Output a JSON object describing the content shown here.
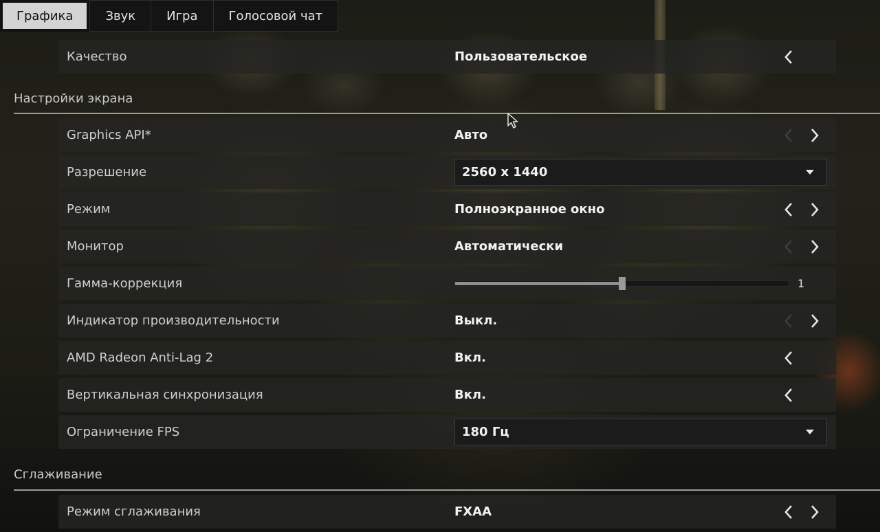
{
  "tabs": [
    {
      "label": "Графика",
      "active": true
    },
    {
      "label": "Звук",
      "active": false
    },
    {
      "label": "Игра",
      "active": false
    },
    {
      "label": "Голосовой чат",
      "active": false
    }
  ],
  "quality": {
    "label": "Качество",
    "value": "Пользовательское"
  },
  "sections": {
    "screen": "Настройки экрана",
    "antialiasing": "Сглаживание"
  },
  "screen_settings": {
    "graphics_api": {
      "label": "Graphics API*",
      "value": "Авто"
    },
    "resolution": {
      "label": "Разрешение",
      "value": "2560 x 1440"
    },
    "mode": {
      "label": "Режим",
      "value": "Полноэкранное окно"
    },
    "monitor": {
      "label": "Монитор",
      "value": "Автоматически"
    },
    "gamma": {
      "label": "Гамма-коррекция",
      "value": "1",
      "fill_fraction": 0.5
    },
    "perf_indicator": {
      "label": "Индикатор производительности",
      "value": "Выкл."
    },
    "anti_lag": {
      "label": "AMD Radeon Anti-Lag 2",
      "value": "Вкл."
    },
    "vsync": {
      "label": "Вертикальная синхронизация",
      "value": "Вкл."
    },
    "fps_limit": {
      "label": "Ограничение FPS",
      "value": "180 Гц"
    }
  },
  "aa_settings": {
    "aa_mode": {
      "label": "Режим сглаживания",
      "value": "FXAA"
    }
  },
  "icons": {
    "arrow_left": "chevron-left-icon",
    "arrow_right": "chevron-right-icon",
    "dropdown": "caret-down-icon",
    "cursor": "mouse-cursor-icon"
  },
  "colors": {
    "active_tab_bg": "#d4d4d4",
    "row_bg": "#242422",
    "value_text": "#f2f2f2",
    "label_text": "#cfcfcf"
  }
}
